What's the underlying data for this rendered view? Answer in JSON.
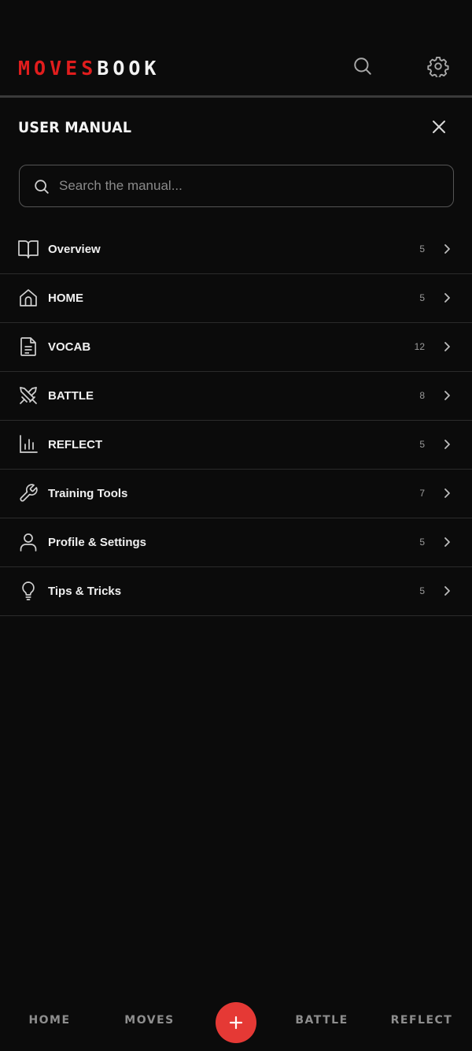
{
  "header": {
    "logo_red": "MOVES",
    "logo_white": "BOOK"
  },
  "manual": {
    "title": "USER MANUAL",
    "search_placeholder": "Search the manual..."
  },
  "sections": [
    {
      "label": "Overview",
      "count": "5",
      "icon": "book-open-icon"
    },
    {
      "label": "HOME",
      "count": "5",
      "icon": "home-icon"
    },
    {
      "label": "VOCAB",
      "count": "12",
      "icon": "document-icon"
    },
    {
      "label": "BATTLE",
      "count": "8",
      "icon": "crossed-swords-icon"
    },
    {
      "label": "REFLECT",
      "count": "5",
      "icon": "bar-chart-icon"
    },
    {
      "label": "Training Tools",
      "count": "7",
      "icon": "wrench-icon"
    },
    {
      "label": "Profile & Settings",
      "count": "5",
      "icon": "user-icon"
    },
    {
      "label": "Tips & Tricks",
      "count": "5",
      "icon": "lightbulb-icon"
    }
  ],
  "nav": {
    "home": "HOME",
    "moves": "MOVES",
    "battle": "BATTLE",
    "reflect": "REFLECT"
  },
  "colors": {
    "brand_red": "#e11d1d",
    "fab_red": "#e53935",
    "background": "#0b0b0b"
  }
}
